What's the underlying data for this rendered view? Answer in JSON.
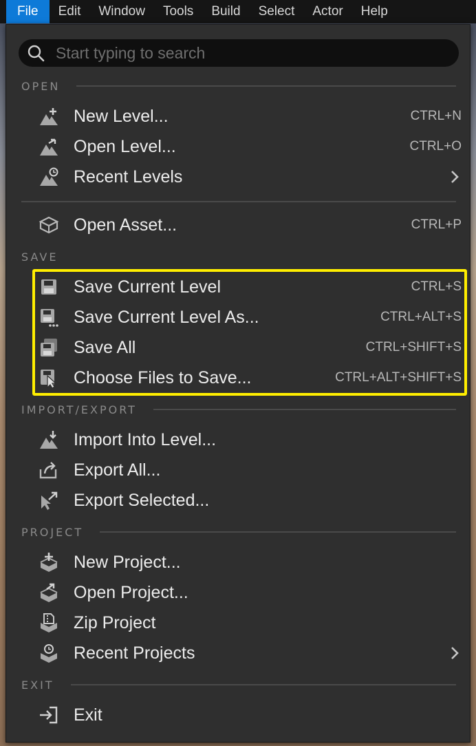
{
  "menubar": {
    "items": [
      "File",
      "Edit",
      "Window",
      "Tools",
      "Build",
      "Select",
      "Actor",
      "Help"
    ],
    "active": "File"
  },
  "search": {
    "placeholder": "Start typing to search"
  },
  "sections": {
    "open": "OPEN",
    "save": "SAVE",
    "import_export": "IMPORT/EXPORT",
    "project": "PROJECT",
    "exit": "EXIT"
  },
  "items": {
    "new_level": {
      "label": "New Level...",
      "shortcut": "CTRL+N",
      "icon": "new-level-icon"
    },
    "open_level": {
      "label": "Open Level...",
      "shortcut": "CTRL+O",
      "icon": "open-level-icon"
    },
    "recent_levels": {
      "label": "Recent Levels",
      "icon": "recent-levels-icon"
    },
    "open_asset": {
      "label": "Open Asset...",
      "shortcut": "CTRL+P",
      "icon": "open-asset-icon"
    },
    "save_current_level": {
      "label": "Save Current Level",
      "shortcut": "CTRL+S",
      "icon": "save-icon"
    },
    "save_current_level_as": {
      "label": "Save Current Level As...",
      "shortcut": "CTRL+ALT+S",
      "icon": "save-as-icon"
    },
    "save_all": {
      "label": "Save All",
      "shortcut": "CTRL+SHIFT+S",
      "icon": "save-all-icon"
    },
    "choose_files": {
      "label": "Choose Files to Save...",
      "shortcut": "CTRL+ALT+SHIFT+S",
      "icon": "choose-files-icon"
    },
    "import_into_level": {
      "label": "Import Into Level...",
      "icon": "import-icon"
    },
    "export_all": {
      "label": "Export All...",
      "icon": "export-all-icon"
    },
    "export_selected": {
      "label": "Export Selected...",
      "icon": "export-selected-icon"
    },
    "new_project": {
      "label": "New Project...",
      "icon": "new-project-icon"
    },
    "open_project": {
      "label": "Open Project...",
      "icon": "open-project-icon"
    },
    "zip_project": {
      "label": "Zip Project",
      "icon": "zip-project-icon"
    },
    "recent_projects": {
      "label": "Recent Projects",
      "icon": "recent-projects-icon"
    },
    "exit": {
      "label": "Exit",
      "icon": "exit-icon"
    }
  },
  "colors": {
    "accent": "#0e7ad8",
    "highlight": "#ffee00",
    "menu_bg": "#2f2f2f"
  }
}
